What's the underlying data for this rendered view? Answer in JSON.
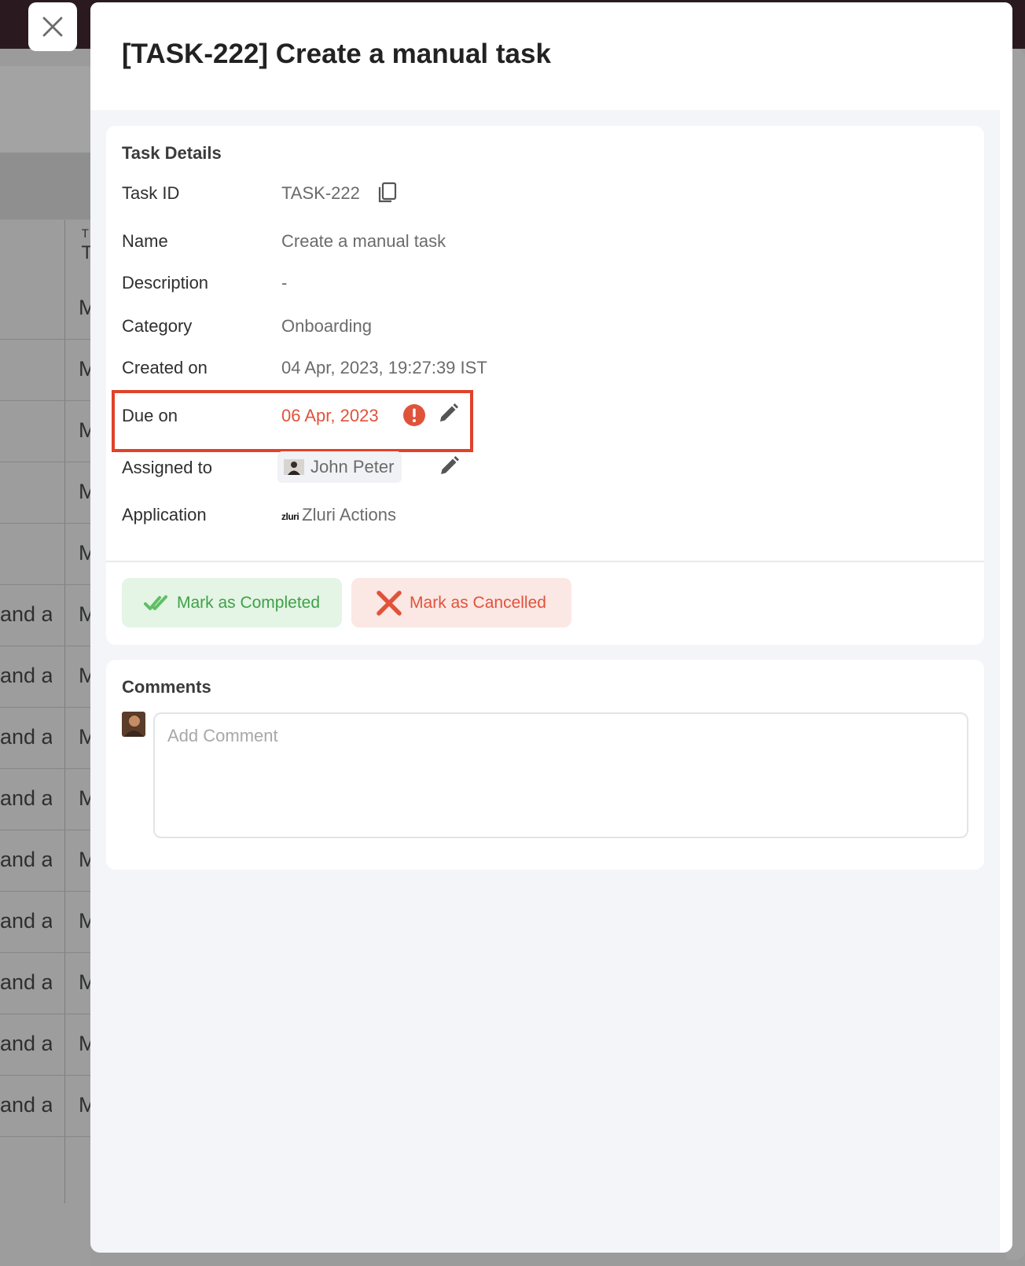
{
  "drawer": {
    "title": "[TASK-222] Create a manual task"
  },
  "details": {
    "heading": "Task Details",
    "task_id_label": "Task ID",
    "task_id": "TASK-222",
    "name_label": "Name",
    "name": "Create a manual task",
    "description_label": "Description",
    "description": "-",
    "category_label": "Category",
    "category": "Onboarding",
    "created_label": "Created on",
    "created": "04 Apr, 2023, 19:27:39 IST",
    "due_label": "Due on",
    "due": "06 Apr, 2023",
    "assigned_label": "Assigned to",
    "assignee": "John Peter",
    "application_label": "Application",
    "application_logo_text": "zluri",
    "application": "Zluri Actions"
  },
  "actions": {
    "complete_label": "Mark as Completed",
    "cancel_label": "Mark as Cancelled"
  },
  "comments": {
    "heading": "Comments",
    "placeholder": "Add Comment"
  },
  "background_rows": [
    {
      "c1": "",
      "c2": "M"
    },
    {
      "c1": "",
      "c2": "M"
    },
    {
      "c1": "",
      "c2": "M"
    },
    {
      "c1": "",
      "c2": "M"
    },
    {
      "c1": "",
      "c2": "M"
    },
    {
      "c1": "and a",
      "c2": "M"
    },
    {
      "c1": "and a",
      "c2": "M"
    },
    {
      "c1": "and a",
      "c2": "M"
    },
    {
      "c1": "and a",
      "c2": "M"
    },
    {
      "c1": "and a",
      "c2": "M"
    },
    {
      "c1": "and a",
      "c2": "M"
    },
    {
      "c1": "and a",
      "c2": "M"
    },
    {
      "c1": "and a",
      "c2": "M"
    },
    {
      "c1": "and a",
      "c2": "M"
    }
  ],
  "background_header": "T",
  "colors": {
    "overdue": "#e0533b",
    "highlight_border": "#e0422a",
    "complete_green": "#3fa148",
    "complete_bg": "#e4f4e5",
    "cancel_bg": "#fbe7e4"
  },
  "icons": [
    "close-icon",
    "copy-icon",
    "alert-icon",
    "pencil-icon",
    "checkmark-double-icon",
    "x-icon",
    "avatar",
    "zluri-logo"
  ]
}
